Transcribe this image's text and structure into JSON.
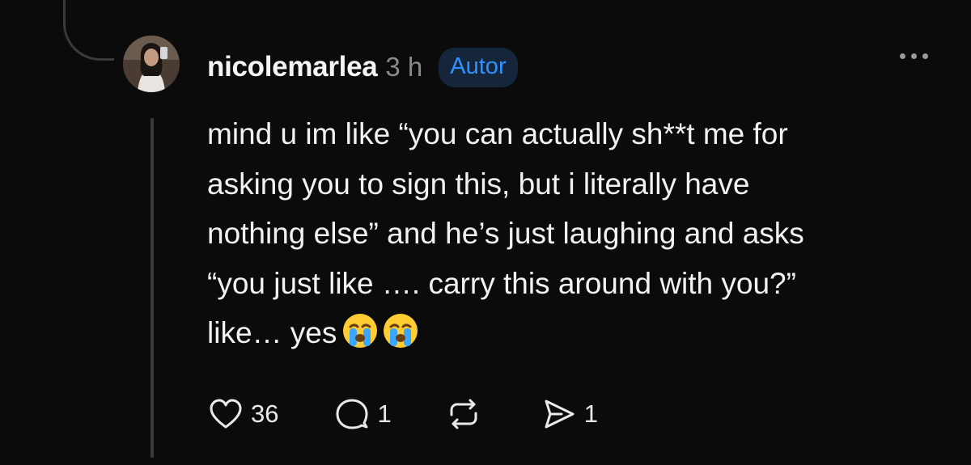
{
  "post": {
    "username": "nicolemarlea",
    "timestamp": "3 h",
    "badge": "Autor",
    "text_lines": [
      "mind u im like “you can actually sh**t me for",
      "asking you to sign this, but i literally have",
      "nothing else” and he’s just laughing and asks",
      "“you just like …. carry this around with you?”",
      "like… yes"
    ],
    "emoji": [
      "loudly-crying-face",
      "loudly-crying-face"
    ]
  },
  "actions": {
    "likes": "36",
    "replies": "1",
    "reposts": "",
    "shares": "1",
    "icons": [
      "heart-icon",
      "comment-icon",
      "repost-icon",
      "send-icon"
    ]
  },
  "colors": {
    "background": "#0b0b0b",
    "text": "#f2f2f2",
    "muted": "#8a8a8a",
    "badge_text": "#2e93ff",
    "badge_bg": "#15263a",
    "thread_line": "#3a3a3a"
  }
}
